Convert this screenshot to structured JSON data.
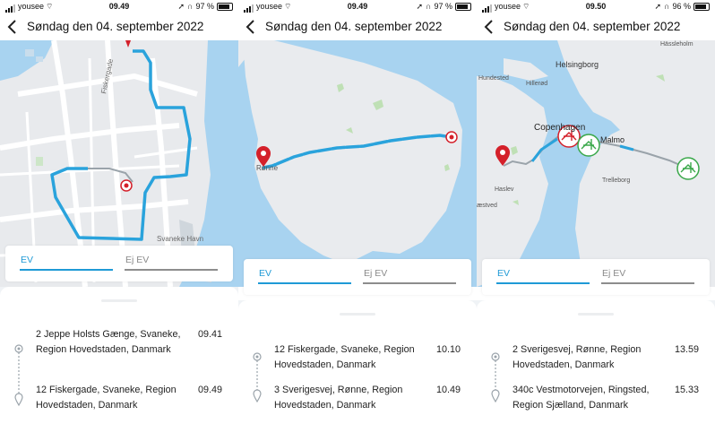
{
  "screens": [
    {
      "status": {
        "carrier": "yousee",
        "time": "09.49",
        "battery": "97 %"
      },
      "header": {
        "title": "Søndag den 04. september 2022"
      },
      "map": {
        "labels": {
          "street": "Fiskergade",
          "harbor": "Svaneke Havn"
        }
      },
      "tabs": {
        "ev": "EV",
        "not_ev": "Ej EV"
      },
      "trip": {
        "from": "2 Jeppe Holsts Gænge, Svaneke, Region Hovedstaden, Danmark",
        "from_time": "09.41",
        "to": "12 Fiskergade, Svaneke, Region Hovedstaden, Danmark",
        "to_time": "09.49"
      }
    },
    {
      "status": {
        "carrier": "yousee",
        "time": "09.49",
        "battery": "97 %"
      },
      "header": {
        "title": "Søndag den 04. september 2022"
      },
      "map": {
        "labels": {
          "town": "Rønne"
        }
      },
      "tabs": {
        "ev": "EV",
        "not_ev": "Ej EV"
      },
      "trip": {
        "from": "12 Fiskergade, Svaneke, Region Hovedstaden, Danmark",
        "from_time": "10.10",
        "to": "3 Sverigesvej, Rønne, Region Hovedstaden, Danmark",
        "to_time": "10.49"
      }
    },
    {
      "status": {
        "carrier": "yousee",
        "time": "09.50",
        "battery": "96 %"
      },
      "header": {
        "title": "Søndag den 04. september 2022"
      },
      "map": {
        "labels": {
          "hassleholm": "Hässleholm",
          "helsingborg": "Helsingborg",
          "hundested": "Hundested",
          "hillerod": "Hillerød",
          "copenhagen": "Copenhagen",
          "malmo": "Malmo",
          "haslev": "Haslev",
          "naestved": "æstved",
          "trelleborg": "Trelleborg"
        }
      },
      "tabs": {
        "ev": "EV",
        "not_ev": "Ej EV"
      },
      "trip": {
        "from": "2 Sverigesvej, Rønne, Region Hovedstaden, Danmark",
        "from_time": "13.59",
        "to": "340c Vestmotorvejen, Ringsted, Region Sjælland, Danmark",
        "to_time": "15.33"
      }
    }
  ],
  "colors": {
    "route": "#2aa3dc",
    "accent": "#1f9ad6",
    "pin": "#d4202a",
    "charger_green": "#3aa84a"
  }
}
